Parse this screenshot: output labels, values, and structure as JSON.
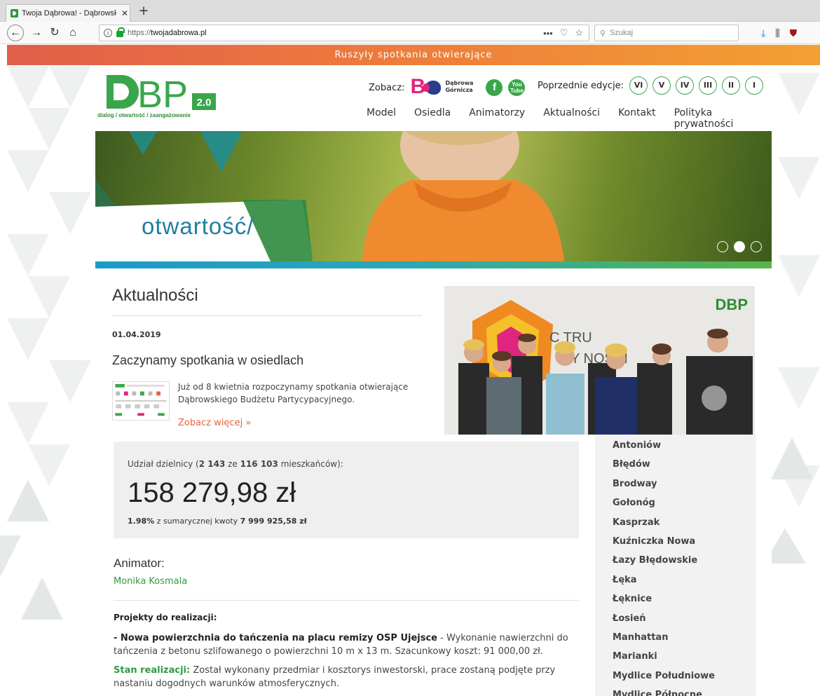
{
  "browser": {
    "tab_title": "Twoja Dąbrowa! - Dąbrowski B",
    "tab_close": "✕",
    "new_tab": "+",
    "url_protocol": "https://",
    "url_host": "twojadabrowa.pl",
    "url_actions": "•••",
    "search_placeholder": "Szukaj"
  },
  "topbar": {
    "text": "Ruszyły spotkania otwierające"
  },
  "header": {
    "logo_text": "dialog / otwartość / zaangażowanie",
    "zobacz_label": "Zobacz:",
    "partner_name_line1": "Dąbrowa",
    "partner_name_line2": "Górnicza",
    "facebook_label": "f",
    "youtube_label": "You Tube",
    "editions_label": "Poprzednie edycje:",
    "editions": [
      "VI",
      "V",
      "IV",
      "III",
      "II",
      "I"
    ],
    "nav": [
      "Model",
      "Osiedla",
      "Animatorzy",
      "Aktualności",
      "Kontakt",
      "Polityka prywatności"
    ]
  },
  "hero": {
    "caption": "otwartość/",
    "slides_total": 3,
    "active_slide": 2
  },
  "news": {
    "title": "Aktualności",
    "date": "01.04.2019",
    "headline": "Zaczynamy spotkania w osiedlach",
    "excerpt": "Już od 8 kwietnia rozpoczynamy spotkania otwierające Dąbrowskiego Budżetu Partycypacyjnego.",
    "more_link": "Zobacz więcej »"
  },
  "stats": {
    "share_prefix": "Udział dzielnicy (",
    "share_residents": "2 143",
    "share_mid": " ze ",
    "share_total": "116 103",
    "share_suffix": " mieszkańców):",
    "amount": "158 279,98 zł",
    "percent": "1.98%",
    "percent_text": " z sumarycznej kwoty ",
    "total_amount": "7 999 925,58 zł"
  },
  "animator": {
    "heading": "Animator:",
    "name": "Monika Kosmala"
  },
  "projects": {
    "heading": "Projekty do realizacji:",
    "item_title": "- Nowa powierzchnia do tańczenia na placu remizy OSP Ujejsce",
    "item_desc": " - Wykonanie nawierzchni do tańczenia z betonu szlifowanego o powierzchni 10 m x 13 m. Szacunkowy koszt: 91 000,00 zł.",
    "status_label": "Stan realizacji:",
    "status_text": " Został wykonany przedmiar i kosztorys inwestorski, prace zostaną podjęte przy nastaniu dogodnych warunków atmosferycznych."
  },
  "districts": [
    "Antoniów",
    "Błędów",
    "Brodway",
    "Gołonóg",
    "Kasprzak",
    "Kuźniczka Nowa",
    "Łazy Błędowskie",
    "Łęka",
    "Łęknice",
    "Łosień",
    "Manhattan",
    "Marianki",
    "Mydlice Południowe",
    "Mydlice Północne"
  ],
  "colors": {
    "brand_green": "#3aa64c",
    "accent_orange": "#e7643a",
    "topbar_start": "#e05e4a",
    "topbar_end": "#f2a033",
    "partner_pink": "#e0257e"
  }
}
